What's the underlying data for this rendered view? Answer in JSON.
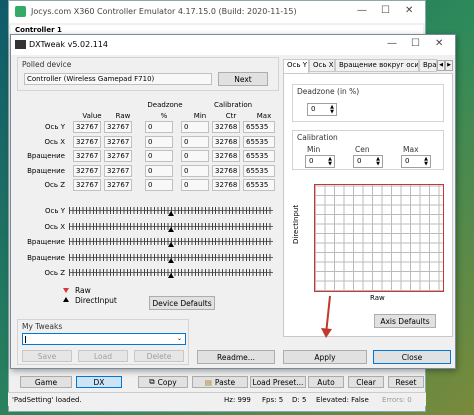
{
  "back_window": {
    "title": "Jocys.com X360 Controller Emulator 4.17.15.0 (Build: 2020-11-15)",
    "panel_label": "Controller 1",
    "bottom_buttons": [
      "Game",
      "DX",
      "Copy",
      "Paste",
      "Load Preset...",
      "Auto",
      "Clear",
      "Reset"
    ],
    "status": {
      "left": "'PadSetting' loaded.",
      "hz": "Hz: 999",
      "fps": "Fps: 5",
      "d": "D: 5",
      "elevated": "Elevated: False",
      "errors": "Errors: 0"
    }
  },
  "dxtweak": {
    "title": "DXTweak v5.02.114",
    "polled_device_label": "Polled device",
    "polled_device_value": "Controller (Wireless Gamepad F710)",
    "next_label": "Next",
    "headers": {
      "value": "Value",
      "raw": "Raw",
      "deadzone": "Deadzone",
      "deadzone_unit": "%",
      "calibration": "Calibration",
      "min": "Min",
      "ctr": "Ctr",
      "max": "Max"
    },
    "axes": [
      {
        "label": "Ось Y",
        "value": "32767",
        "raw": "32767",
        "dz": "0",
        "min": "0",
        "ctr": "32768",
        "max": "65535"
      },
      {
        "label": "Ось X",
        "value": "32767",
        "raw": "32767",
        "dz": "0",
        "min": "0",
        "ctr": "32768",
        "max": "65535"
      },
      {
        "label": "Вращение",
        "value": "32767",
        "raw": "32767",
        "dz": "0",
        "min": "0",
        "ctr": "32768",
        "max": "65535"
      },
      {
        "label": "Вращение",
        "value": "32767",
        "raw": "32767",
        "dz": "0",
        "min": "0",
        "ctr": "32768",
        "max": "65535"
      },
      {
        "label": "Ось Z",
        "value": "32767",
        "raw": "32767",
        "dz": "0",
        "min": "0",
        "ctr": "32768",
        "max": "65535"
      }
    ],
    "slider_labels": [
      "Ось Y",
      "Ось X",
      "Вращение",
      "Вращение",
      "Ось Z"
    ],
    "slider_position": 0.5,
    "legend": {
      "raw": "Raw",
      "directinput": "DirectInput"
    },
    "device_defaults_label": "Device Defaults",
    "my_tweaks_label": "My Tweaks",
    "save_label": "Save",
    "load_label": "Load",
    "delete_label": "Delete",
    "tabs": [
      "Ось Y",
      "Ось X",
      "Вращение вокруг оси Y",
      "Вра"
    ],
    "deadzone_label": "Deadzone (in %)",
    "deadzone_value": "0",
    "calibration_label": "Calibration",
    "cal_min_label": "Min",
    "cal_cen_label": "Cen",
    "cal_max_label": "Max",
    "cal_min": "0",
    "cal_cen": "0",
    "cal_max": "0",
    "y_axis_label": "DirectInput",
    "x_axis_label": "Raw",
    "axis_defaults_label": "Axis Defaults",
    "readme_label": "Readme...",
    "apply_label": "Apply",
    "close_label": "Close"
  },
  "colors": {
    "accent": "#0078d7",
    "arrow": "#c0392b",
    "graph_border": "#cc3333"
  }
}
